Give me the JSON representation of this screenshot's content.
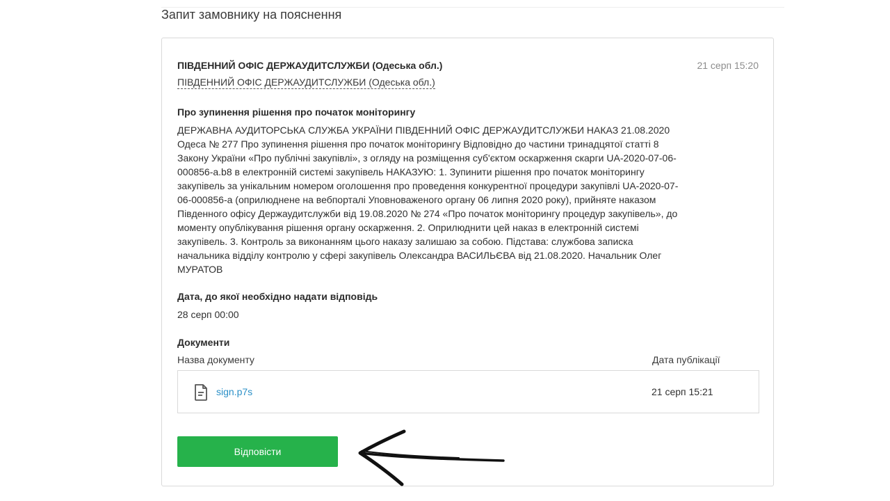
{
  "section": {
    "title": "Запит замовнику на пояснення"
  },
  "request": {
    "author": "ПІВДЕННИЙ ОФІС ДЕРЖАУДИТСЛУЖБИ (Одеська обл.)",
    "author_link": "ПІВДЕННИЙ ОФІС ДЕРЖАУДИТСЛУЖБИ (Одеська обл.)",
    "date": "21 серп 15:20",
    "title": "Про зупинення рішення про початок моніторингу",
    "body": "ДЕРЖАВНА АУДИТОРСЬКА СЛУЖБА УКРАЇНИ ПІВДЕННИЙ ОФІС ДЕРЖАУДИТСЛУЖБИ НАКАЗ 21.08.2020 Одеса № 277 Про зупинення рішення про початок моніторингу Відповідно до частини тринадцятої статті 8 Закону України «Про публічні закупівлі», з огляду на розміщення суб'єктом оскарження скарги UA-2020-07-06-000856-a.b8 в електронній системі закупівель НАКАЗУЮ: 1. Зупинити рішення про початок моніторингу закупівель за унікальним номером оголошення про проведення конкурентної процедури закупівлі UA-2020-07-06-000856-a (оприлюднене на вебпорталі Уповноваженого органу 06 липня 2020 року), прийняте наказом Південного офісу Держаудитслужби від 19.08.2020 № 274 «Про початок моніторингу процедур закупівель», до моменту опублікування рішення органу оскарження. 2. Оприлюднити цей наказ в електронній системі закупівель. 3. Контроль за виконанням цього наказу залишаю за собою. Підстава: службова записка начальника відділу контролю у сфері закупівель Олександра ВАСИЛЬЄВА від 21.08.2020. Начальник Олег МУРАТОВ",
    "due_label": "Дата, до якої необхідно надати відповідь",
    "due_value": "28 серп 00:00"
  },
  "documents": {
    "title": "Документи",
    "col_name": "Назва документу",
    "col_date": "Дата публікації",
    "items": [
      {
        "icon": "document-icon",
        "name": "sign.p7s",
        "date": "21 серп 15:21"
      }
    ]
  },
  "actions": {
    "reply_label": "Відповісти"
  },
  "colors": {
    "accent_green": "#26b24b",
    "link_blue": "#2a8fc7"
  }
}
